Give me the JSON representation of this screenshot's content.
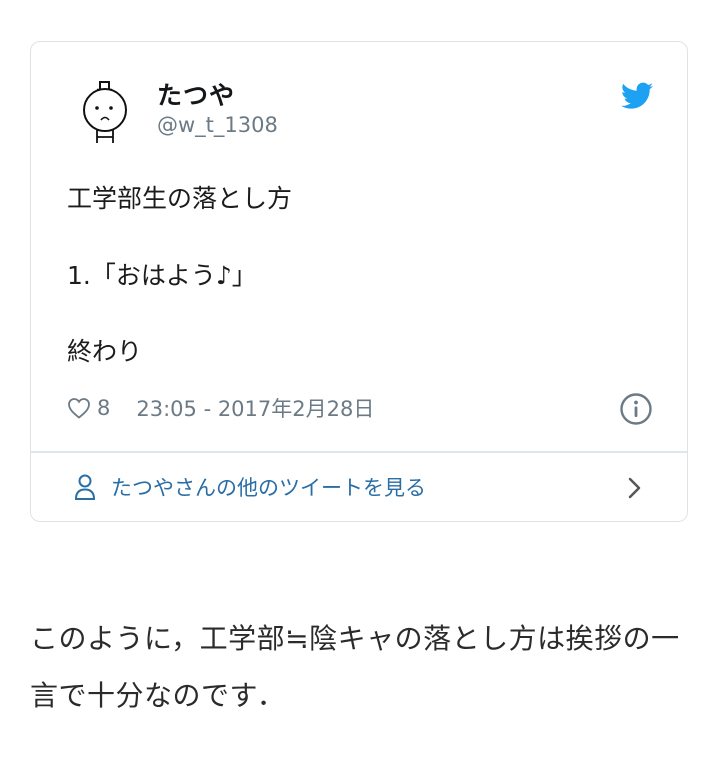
{
  "tweet": {
    "display_name": "たつや",
    "handle": "@w_t_1308",
    "lines": [
      "工学部生の落とし方",
      "1.「おはよう♪」",
      "終わり"
    ],
    "like_count": "8",
    "timestamp": "23:05 - 2017年2月28日",
    "more_tweets_label": "たつやさんの他のツイートを見る"
  },
  "article": {
    "text": "このように，工学部≒陰キャの落とし方は挨拶の一言で十分なのです．"
  },
  "icons": {
    "brand": "twitter-bird-icon",
    "like": "heart-icon",
    "info": "info-icon",
    "more": "person-icon",
    "nav": "chevron-right-icon"
  },
  "colors": {
    "twitter_blue": "#1da1f2",
    "link_blue": "#2a6ea6",
    "muted_gray": "#6b7a85",
    "border": "#dfe3e6"
  }
}
